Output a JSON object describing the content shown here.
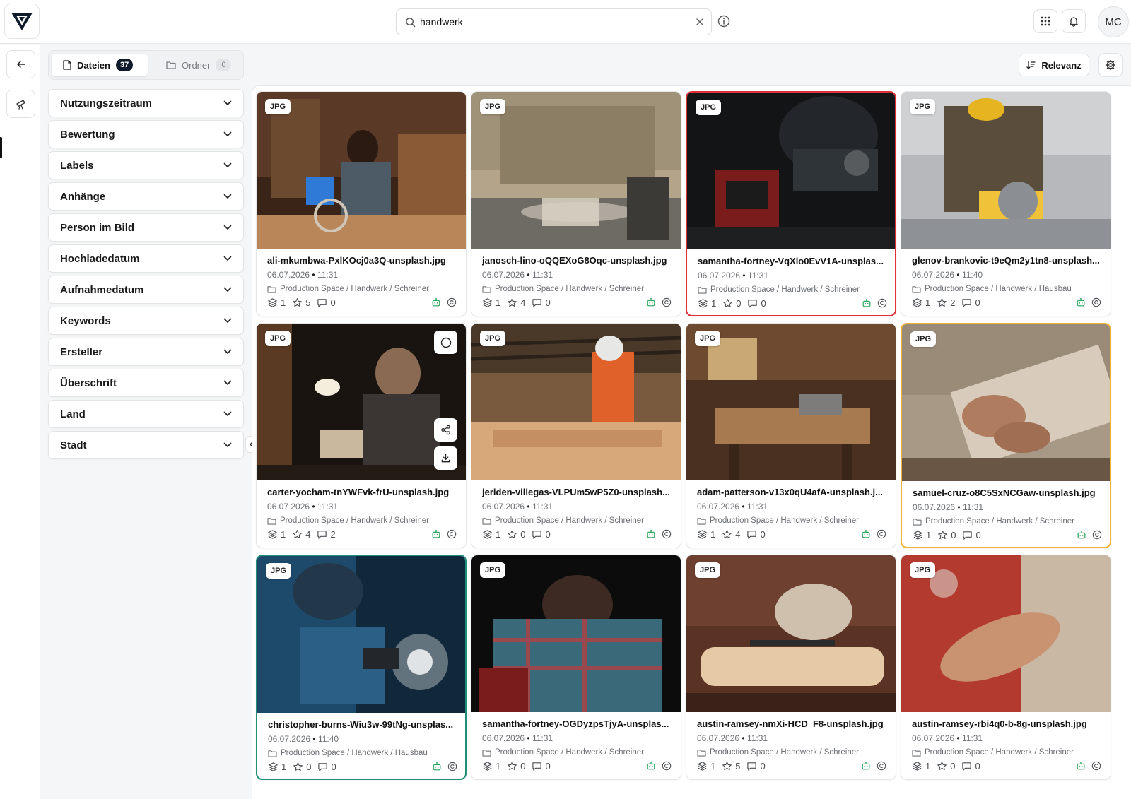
{
  "search": {
    "query": "handwerk"
  },
  "header": {
    "user_initials": "MC"
  },
  "tabs": [
    {
      "label": "Dateien",
      "count": "37"
    },
    {
      "label": "Ordner",
      "count": "0"
    }
  ],
  "filters": [
    "Nutzungszeitraum",
    "Bewertung",
    "Labels",
    "Anhänge",
    "Person im Bild",
    "Hochladedatum",
    "Aufnahmedatum",
    "Keywords",
    "Ersteller",
    "Überschrift",
    "Land",
    "Stadt"
  ],
  "sort": {
    "label": "Relevanz"
  },
  "colors": {
    "selected_red": "#e0303a",
    "selected_orange": "#f1b43a",
    "selected_teal": "#1f8f78",
    "robot_icon": "#2aa55a",
    "count_badge": "#0f1a2a"
  },
  "cards": [
    {
      "type": "JPG",
      "name": "ali-mkumbwa-PxlKOcj0a3Q-unsplash.jpg",
      "date": "06.07.2026",
      "time": "11:31",
      "path": "Production Space / Handwerk / Schreiner",
      "versions": "1",
      "rating": "5",
      "comments": "0"
    },
    {
      "type": "JPG",
      "name": "janosch-lino-oQQEXoG8Oqc-unsplash.jpg",
      "date": "06.07.2026",
      "time": "11:31",
      "path": "Production Space / Handwerk / Schreiner",
      "versions": "1",
      "rating": "4",
      "comments": "0"
    },
    {
      "type": "JPG",
      "name": "samantha-fortney-VqXio0EvV1A-unsplas...",
      "date": "06.07.2026",
      "time": "11:31",
      "path": "Production Space / Handwerk / Schreiner",
      "versions": "1",
      "rating": "0",
      "comments": "0"
    },
    {
      "type": "JPG",
      "name": "glenov-brankovic-t9eQm2y1tn8-unsplash...",
      "date": "06.07.2026",
      "time": "11:40",
      "path": "Production Space / Handwerk / Hausbau",
      "versions": "1",
      "rating": "2",
      "comments": "0"
    },
    {
      "type": "JPG",
      "name": "carter-yocham-tnYWFvk-frU-unsplash.jpg",
      "date": "06.07.2026",
      "time": "11:31",
      "path": "Production Space / Handwerk / Schreiner",
      "versions": "1",
      "rating": "4",
      "comments": "2"
    },
    {
      "type": "JPG",
      "name": "jeriden-villegas-VLPUm5wP5Z0-unsplash...",
      "date": "06.07.2026",
      "time": "11:31",
      "path": "Production Space / Handwerk / Schreiner",
      "versions": "1",
      "rating": "0",
      "comments": "0"
    },
    {
      "type": "JPG",
      "name": "adam-patterson-v13x0qU4afA-unsplash.j...",
      "date": "06.07.2026",
      "time": "11:31",
      "path": "Production Space / Handwerk / Schreiner",
      "versions": "1",
      "rating": "4",
      "comments": "0"
    },
    {
      "type": "JPG",
      "name": "samuel-cruz-o8C5SxNCGaw-unsplash.jpg",
      "date": "06.07.2026",
      "time": "11:31",
      "path": "Production Space / Handwerk / Schreiner",
      "versions": "1",
      "rating": "0",
      "comments": "0"
    },
    {
      "type": "JPG",
      "name": "christopher-burns-Wiu3w-99tNg-unsplas...",
      "date": "06.07.2026",
      "time": "11:40",
      "path": "Production Space / Handwerk / Hausbau",
      "versions": "1",
      "rating": "0",
      "comments": "0"
    },
    {
      "type": "JPG",
      "name": "samantha-fortney-OGDyzpsTjyA-unsplas...",
      "date": "06.07.2026",
      "time": "11:31",
      "path": "Production Space / Handwerk / Schreiner",
      "versions": "1",
      "rating": "0",
      "comments": "0"
    },
    {
      "type": "JPG",
      "name": "austin-ramsey-nmXi-HCD_F8-unsplash.jpg",
      "date": "06.07.2026",
      "time": "11:31",
      "path": "Production Space / Handwerk / Schreiner",
      "versions": "1",
      "rating": "5",
      "comments": "0"
    },
    {
      "type": "JPG",
      "name": "austin-ramsey-rbi4q0-b-8g-unsplash.jpg",
      "date": "06.07.2026",
      "time": "11:31",
      "path": "Production Space / Handwerk / Schreiner",
      "versions": "1",
      "rating": "0",
      "comments": "0"
    }
  ]
}
